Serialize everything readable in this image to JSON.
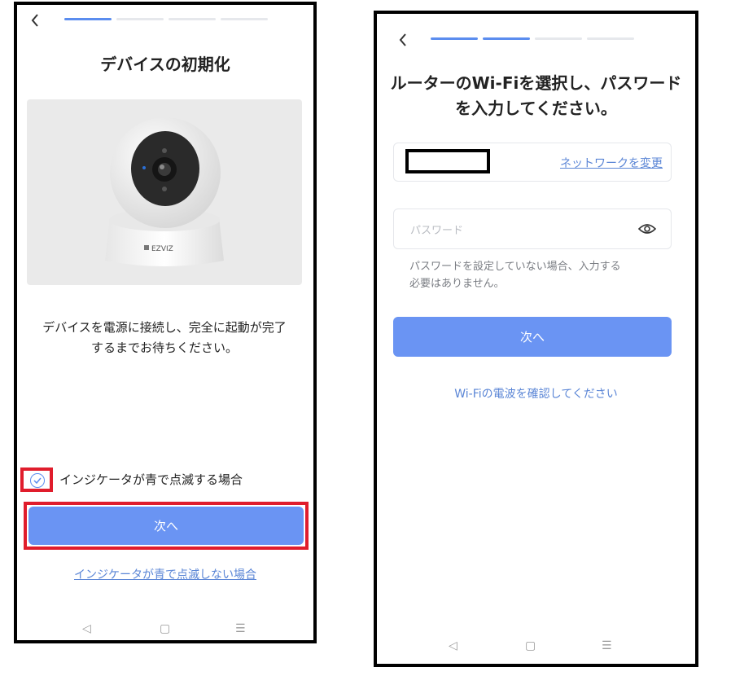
{
  "screen1": {
    "back_icon": "chevron-left-icon",
    "progress": {
      "total": 4,
      "active": 1
    },
    "title": "デバイスの初期化",
    "image_brand": "EZVIZ",
    "description_line1": "デバイスを電源に接続し、完全に起動が完了",
    "description_line2": "するまでお待ちください。",
    "checkbox_label": "インジケータが青で点滅する場合",
    "checkbox_checked": true,
    "next_button": "次へ",
    "alt_link": "インジケータが青で点滅しない場合",
    "nav": {
      "back": "◁",
      "home": "▢",
      "menu": "☰"
    }
  },
  "screen2": {
    "back_icon": "chevron-left-icon",
    "progress": {
      "total": 4,
      "active": 2
    },
    "title_line1": "ルーターのWi-Fiを選択し、パスワード",
    "title_line2": "を入力してください。",
    "network_name": "",
    "change_network": "ネットワークを変更",
    "password_placeholder": "パスワード",
    "hint_line1": "パスワードを設定していない場合、入力する",
    "hint_line2": "必要はありません。",
    "next_button": "次へ",
    "wifi_link": "Wi-Fiの電波を確認してください",
    "nav": {
      "back": "◁",
      "home": "▢",
      "menu": "☰"
    }
  },
  "colors": {
    "accent": "#6a94f3",
    "link": "#5b86d6",
    "highlight": "#e01d2c"
  }
}
